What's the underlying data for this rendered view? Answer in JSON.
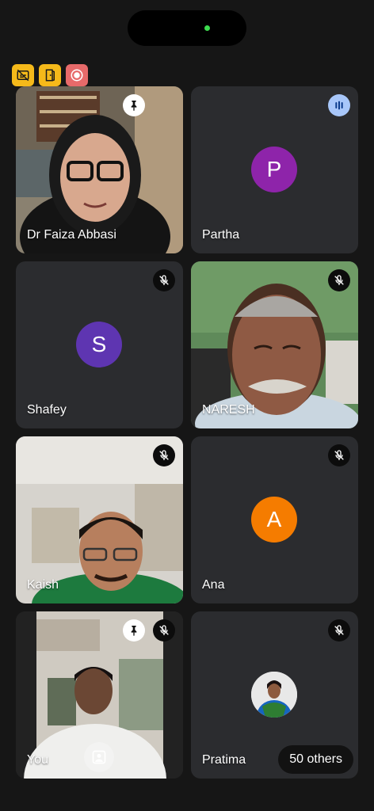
{
  "indicators": [
    {
      "icon": "no-captions-icon",
      "color": "#f5b91a"
    },
    {
      "icon": "door-icon",
      "color": "#f5b91a"
    },
    {
      "icon": "recording-icon",
      "color": "#e76a6a"
    }
  ],
  "participants": [
    {
      "name": "Dr Faiza Abbasi",
      "type": "video",
      "pinned": true,
      "muted": false
    },
    {
      "name": "Partha",
      "type": "avatar",
      "letter": "P",
      "avatar_color": "#8e24aa",
      "speaking": true
    },
    {
      "name": "Shafey",
      "type": "avatar",
      "letter": "S",
      "avatar_color": "#5e35b1",
      "muted": true
    },
    {
      "name": "NARESH",
      "type": "video",
      "muted": true
    },
    {
      "name": "Kaish",
      "type": "video",
      "muted": true
    },
    {
      "name": "Ana",
      "type": "avatar",
      "letter": "A",
      "avatar_color": "#f57c00",
      "muted": true
    },
    {
      "name": "You",
      "type": "video",
      "pinned": true,
      "muted": true
    },
    {
      "name": "Pratima",
      "type": "photo-avatar",
      "muted": true
    }
  ],
  "others_label": "50 others"
}
